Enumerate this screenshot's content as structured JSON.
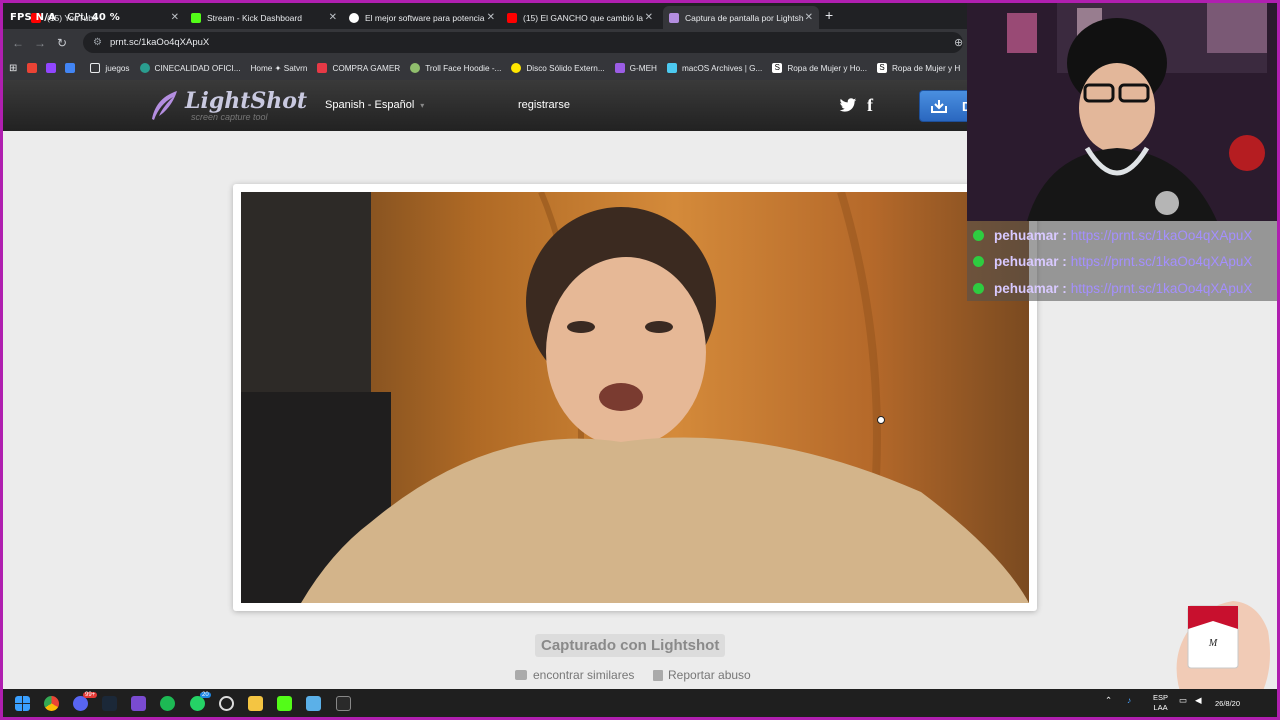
{
  "overlay": {
    "fps_label": "FPS",
    "fps_value": "N/A",
    "cpu_label": "CPU",
    "cpu_value": "40 %"
  },
  "tabs": [
    {
      "title": "(15) YouTube",
      "favicon_color": "#ff0000",
      "active": false
    },
    {
      "title": "Stream - Kick Dashboard",
      "favicon_color": "#53fc18",
      "active": false
    },
    {
      "title": "El mejor software para potencia",
      "favicon_color": "#ffffff",
      "active": false
    },
    {
      "title": "(15) El GANCHO que cambió la",
      "favicon_color": "#ff0000",
      "active": false
    },
    {
      "title": "Captura de pantalla por Lightsh",
      "favicon_color": "#b48ee0",
      "active": true
    }
  ],
  "address": {
    "url": "prnt.sc/1kaOo4qXApuX"
  },
  "bookmarks": [
    {
      "label": "juegos",
      "icon": "folder-icon",
      "color": "#e8eaed"
    },
    {
      "label": "CINECALIDAD OFICI...",
      "icon": "cinecalidad-icon",
      "color": "#2a9d8f"
    },
    {
      "label": "Home ✦ Satvrn",
      "icon": "star-icon",
      "color": "#e8eaed"
    },
    {
      "label": "COMPRA GAMER",
      "icon": "compragamer-icon",
      "color": "#e63946"
    },
    {
      "label": "Troll Face Hoodie -...",
      "icon": "trollface-icon",
      "color": "#90be6d"
    },
    {
      "label": "Disco Sólido Extern...",
      "icon": "mercadolibre-icon",
      "color": "#ffe600"
    },
    {
      "label": "G-MEH",
      "icon": "gmeh-icon",
      "color": "#9b5de5"
    },
    {
      "label": "macOS Archives | G...",
      "icon": "macos-icon",
      "color": "#4cc9f0"
    },
    {
      "label": "Ropa de Mujer y Ho...",
      "icon": "shein-icon",
      "color": "#ffffff"
    },
    {
      "label": "Ropa de Mujer y H",
      "icon": "shein-icon",
      "color": "#ffffff"
    }
  ],
  "lightshot": {
    "logo_name": "LightShot",
    "logo_sub": "screen capture tool",
    "language": "Spanish - Español",
    "register": "registrarse",
    "download_label": "D",
    "caption": "Capturado con Lightshot",
    "similar": "encontrar similares",
    "report": "Reportar abuso"
  },
  "chat": [
    {
      "user": "pehuamar",
      "message": "https://prnt.sc/1kaOo4qXApuX"
    },
    {
      "user": "pehuamar",
      "message": "https://prnt.sc/1kaOo4qXApuX"
    },
    {
      "user": "pehuamar",
      "message": "https://prnt.sc/1kaOo4qXApuX"
    }
  ],
  "taskbar": {
    "badges": {
      "discord": "99+",
      "whatsapp": "20"
    },
    "lang_top": "ESP",
    "lang_bottom": "LAA",
    "clock": "26/8/20"
  }
}
